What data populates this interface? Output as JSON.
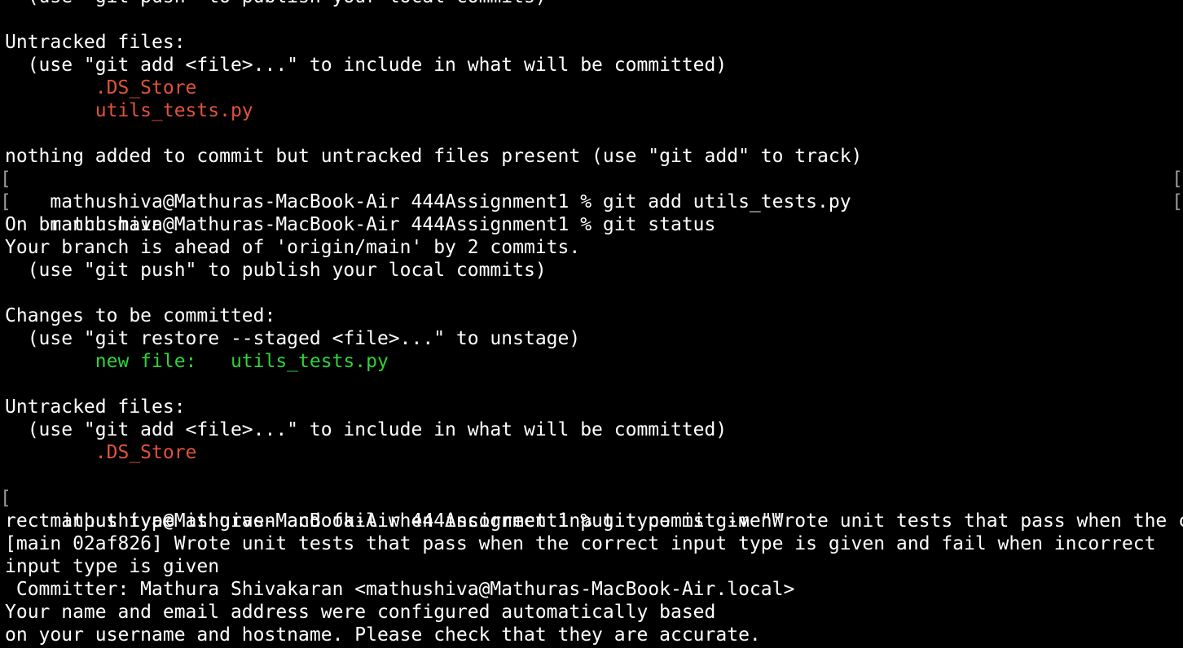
{
  "terminal": {
    "colors": {
      "background": "#000000",
      "text": "#ffffff",
      "untracked": "#e0533a",
      "staged": "#2fd23a"
    },
    "lines": [
      "  (use \"git push\" to publish your local commits)",
      "",
      "Untracked files:",
      "  (use \"git add <file>...\" to include in what will be committed)",
      "\t.DS_Store",
      "\tutils_tests.py",
      "",
      "nothing added to commit but untracked files present (use \"git add\" to track)",
      "mathushiva@Mathuras-MacBook-Air 444Assignment1 % git add utils_tests.py",
      "mathushiva@Mathuras-MacBook-Air 444Assignment1 % git status",
      "On branch main",
      "Your branch is ahead of 'origin/main' by 2 commits.",
      "  (use \"git push\" to publish your local commits)",
      "",
      "Changes to be committed:",
      "  (use \"git restore --staged <file>...\" to unstage)",
      "\tnew file:   utils_tests.py",
      "",
      "Untracked files:",
      "  (use \"git add <file>...\" to include in what will be committed)",
      "\t.DS_Store",
      "",
      "mathushiva@Mathuras-MacBook-Air 444Assignment1 % git commit -m \"Wrote unit tests that pass when the cor",
      "rect input type is given and fail when incorrect input type is given\"",
      "[main 02af826] Wrote unit tests that pass when the correct input type is given and fail when incorrect",
      "input type is given",
      " Committer: Mathura Shivakaran <mathushiva@Mathuras-MacBook-Air.local>",
      "Your name and email address were configured automatically based",
      "on your username and hostname. Please check that they are accurate."
    ],
    "bracket": "[",
    "closing_bracket": "["
  }
}
